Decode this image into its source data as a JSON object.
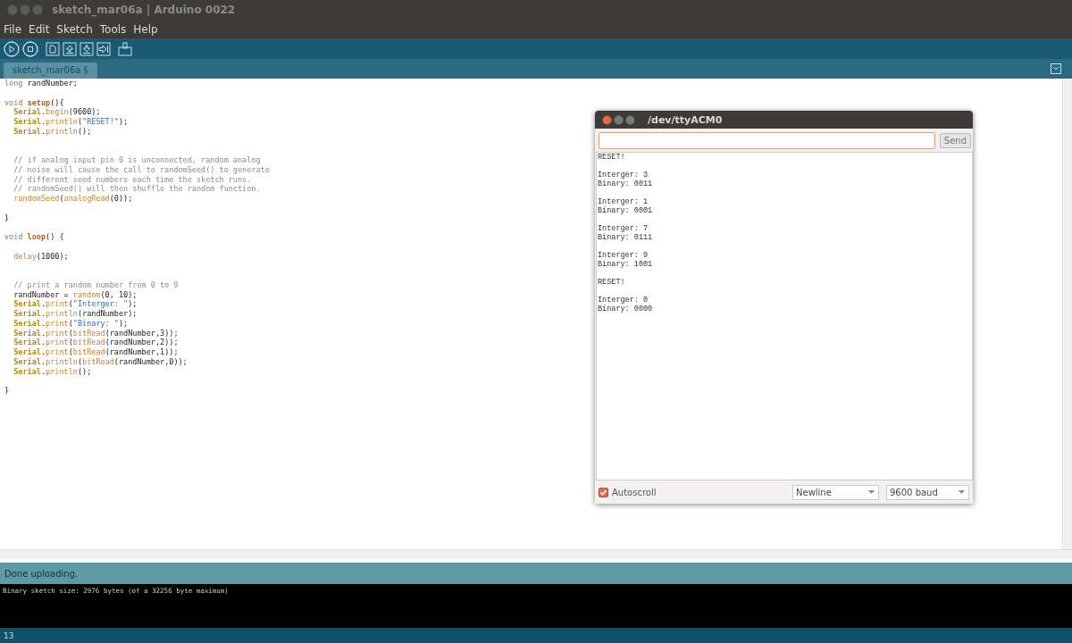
{
  "window": {
    "title": "sketch_mar06a | Arduino 0022"
  },
  "menu": [
    "File",
    "Edit",
    "Sketch",
    "Tools",
    "Help"
  ],
  "toolbar": [
    {
      "kind": "run"
    },
    {
      "kind": "stop"
    },
    {
      "kind": "new"
    },
    {
      "kind": "open"
    },
    {
      "kind": "save"
    },
    {
      "kind": "upload"
    },
    {
      "kind": "monitor"
    }
  ],
  "tabs": [
    {
      "label": "sketch_mar06a §",
      "selected": true
    }
  ],
  "code": [
    {
      "kind": "line",
      "tokens": [
        {
          "kind": "kw",
          "text": "long"
        },
        {
          "kind": "plain",
          "text": " randNumber;"
        }
      ]
    },
    {
      "kind": "blank"
    },
    {
      "kind": "line",
      "tokens": [
        {
          "kind": "kw",
          "text": "void"
        },
        {
          "kind": "fn",
          "text": " setup"
        },
        {
          "kind": "plain",
          "text": "(){"
        }
      ]
    },
    {
      "kind": "line",
      "tokens": [
        {
          "kind": "cls",
          "text": "  Serial"
        },
        {
          "kind": "plain",
          "text": "."
        },
        {
          "kind": "method",
          "text": "begin"
        },
        {
          "kind": "plain",
          "text": "(9600);"
        }
      ]
    },
    {
      "kind": "line",
      "tokens": [
        {
          "kind": "cls",
          "text": "  Serial"
        },
        {
          "kind": "plain",
          "text": "."
        },
        {
          "kind": "method",
          "text": "println"
        },
        {
          "kind": "plain",
          "text": "("
        },
        {
          "kind": "str",
          "text": "\"RESET!\""
        },
        {
          "kind": "plain",
          "text": ");"
        }
      ]
    },
    {
      "kind": "line",
      "tokens": [
        {
          "kind": "cls",
          "text": "  Serial"
        },
        {
          "kind": "plain",
          "text": "."
        },
        {
          "kind": "method",
          "text": "println"
        },
        {
          "kind": "plain",
          "text": "();"
        }
      ]
    },
    {
      "kind": "blank"
    },
    {
      "kind": "blank"
    },
    {
      "kind": "line",
      "tokens": [
        {
          "kind": "cmt",
          "text": "  // if analog input pin 0 is unconnected, random analog"
        }
      ]
    },
    {
      "kind": "line",
      "tokens": [
        {
          "kind": "cmt",
          "text": "  // noise will cause the call to randomSeed() to generate"
        }
      ]
    },
    {
      "kind": "line",
      "tokens": [
        {
          "kind": "cmt",
          "text": "  // different seed numbers each time the sketch runs."
        }
      ]
    },
    {
      "kind": "line",
      "tokens": [
        {
          "kind": "cmt",
          "text": "  // randomSeed() will then shuffle the random function."
        }
      ]
    },
    {
      "kind": "line",
      "tokens": [
        {
          "kind": "method",
          "text": "  randomSeed"
        },
        {
          "kind": "plain",
          "text": "("
        },
        {
          "kind": "method",
          "text": "analogRead"
        },
        {
          "kind": "plain",
          "text": "(0));"
        }
      ]
    },
    {
      "kind": "blank"
    },
    {
      "kind": "line",
      "tokens": [
        {
          "kind": "plain",
          "text": "}"
        }
      ]
    },
    {
      "kind": "blank"
    },
    {
      "kind": "line",
      "tokens": [
        {
          "kind": "kw",
          "text": "void"
        },
        {
          "kind": "fn",
          "text": " loop"
        },
        {
          "kind": "plain",
          "text": "() {"
        }
      ]
    },
    {
      "kind": "blank"
    },
    {
      "kind": "line",
      "tokens": [
        {
          "kind": "method",
          "text": "  delay"
        },
        {
          "kind": "plain",
          "text": "(1000);"
        }
      ]
    },
    {
      "kind": "blank"
    },
    {
      "kind": "blank"
    },
    {
      "kind": "line",
      "tokens": [
        {
          "kind": "cmt",
          "text": "  // print a random number from 0 to 9"
        }
      ]
    },
    {
      "kind": "line",
      "tokens": [
        {
          "kind": "plain",
          "text": "  randNumber = "
        },
        {
          "kind": "method",
          "text": "random"
        },
        {
          "kind": "plain",
          "text": "(0, 10);"
        }
      ]
    },
    {
      "kind": "line",
      "tokens": [
        {
          "kind": "cls",
          "text": "  Serial"
        },
        {
          "kind": "plain",
          "text": "."
        },
        {
          "kind": "method",
          "text": "print"
        },
        {
          "kind": "plain",
          "text": "("
        },
        {
          "kind": "str",
          "text": "\"Interger: \""
        },
        {
          "kind": "plain",
          "text": ");"
        }
      ]
    },
    {
      "kind": "line",
      "tokens": [
        {
          "kind": "cls",
          "text": "  Serial"
        },
        {
          "kind": "plain",
          "text": "."
        },
        {
          "kind": "method",
          "text": "println"
        },
        {
          "kind": "plain",
          "text": "(randNumber);"
        }
      ]
    },
    {
      "kind": "line",
      "tokens": [
        {
          "kind": "cls",
          "text": "  Serial"
        },
        {
          "kind": "plain",
          "text": "."
        },
        {
          "kind": "method",
          "text": "print"
        },
        {
          "kind": "plain",
          "text": "("
        },
        {
          "kind": "str",
          "text": "\"Binary: \""
        },
        {
          "kind": "plain",
          "text": ");"
        }
      ]
    },
    {
      "kind": "line",
      "tokens": [
        {
          "kind": "cls",
          "text": "  Serial"
        },
        {
          "kind": "plain",
          "text": "."
        },
        {
          "kind": "method",
          "text": "print"
        },
        {
          "kind": "plain",
          "text": "("
        },
        {
          "kind": "method",
          "text": "bitRead"
        },
        {
          "kind": "plain",
          "text": "(randNumber,3));"
        }
      ]
    },
    {
      "kind": "line",
      "tokens": [
        {
          "kind": "cls",
          "text": "  Serial"
        },
        {
          "kind": "plain",
          "text": "."
        },
        {
          "kind": "method",
          "text": "print"
        },
        {
          "kind": "plain",
          "text": "("
        },
        {
          "kind": "method",
          "text": "bitRead"
        },
        {
          "kind": "plain",
          "text": "(randNumber,2));"
        }
      ]
    },
    {
      "kind": "line",
      "tokens": [
        {
          "kind": "cls",
          "text": "  Serial"
        },
        {
          "kind": "plain",
          "text": "."
        },
        {
          "kind": "method",
          "text": "print"
        },
        {
          "kind": "plain",
          "text": "("
        },
        {
          "kind": "method",
          "text": "bitRead"
        },
        {
          "kind": "plain",
          "text": "(randNumber,1));"
        }
      ]
    },
    {
      "kind": "line",
      "tokens": [
        {
          "kind": "cls",
          "text": "  Serial"
        },
        {
          "kind": "plain",
          "text": "."
        },
        {
          "kind": "method",
          "text": "println"
        },
        {
          "kind": "plain",
          "text": "("
        },
        {
          "kind": "method",
          "text": "bitRead"
        },
        {
          "kind": "plain",
          "text": "(randNumber,0));"
        }
      ]
    },
    {
      "kind": "line",
      "tokens": [
        {
          "kind": "cls",
          "text": "  Serial"
        },
        {
          "kind": "plain",
          "text": "."
        },
        {
          "kind": "method",
          "text": "println"
        },
        {
          "kind": "plain",
          "text": "();"
        }
      ]
    },
    {
      "kind": "blank"
    },
    {
      "kind": "line",
      "tokens": [
        {
          "kind": "plain",
          "text": "}"
        }
      ]
    }
  ],
  "serial_monitor": {
    "title": "/dev/ttyACM0",
    "send_button": "Send",
    "output": [
      {
        "kind": "line",
        "text": "RESET!"
      },
      {
        "kind": "blank"
      },
      {
        "kind": "line",
        "text": "Interger: 3"
      },
      {
        "kind": "line",
        "text": "Binary: 0011"
      },
      {
        "kind": "blank"
      },
      {
        "kind": "line",
        "text": "Interger: 1"
      },
      {
        "kind": "line",
        "text": "Binary: 0001"
      },
      {
        "kind": "blank"
      },
      {
        "kind": "line",
        "text": "Interger: 7"
      },
      {
        "kind": "line",
        "text": "Binary: 0111"
      },
      {
        "kind": "blank"
      },
      {
        "kind": "line",
        "text": "Interger: 9"
      },
      {
        "kind": "line",
        "text": "Binary: 1001"
      },
      {
        "kind": "blank"
      },
      {
        "kind": "line",
        "text": "RESET!"
      },
      {
        "kind": "blank"
      },
      {
        "kind": "line",
        "text": "Interger: 0"
      },
      {
        "kind": "line",
        "text": "Binary: 0000"
      }
    ],
    "autoscroll": {
      "label": "Autoscroll",
      "checked": true
    },
    "line_ending": "Newline",
    "baud": "9600 baud"
  },
  "status": "Done uploading.",
  "console": [
    "Binary sketch size: 2976 bytes (of a 32256 byte maximum)"
  ],
  "line_number": "13"
}
